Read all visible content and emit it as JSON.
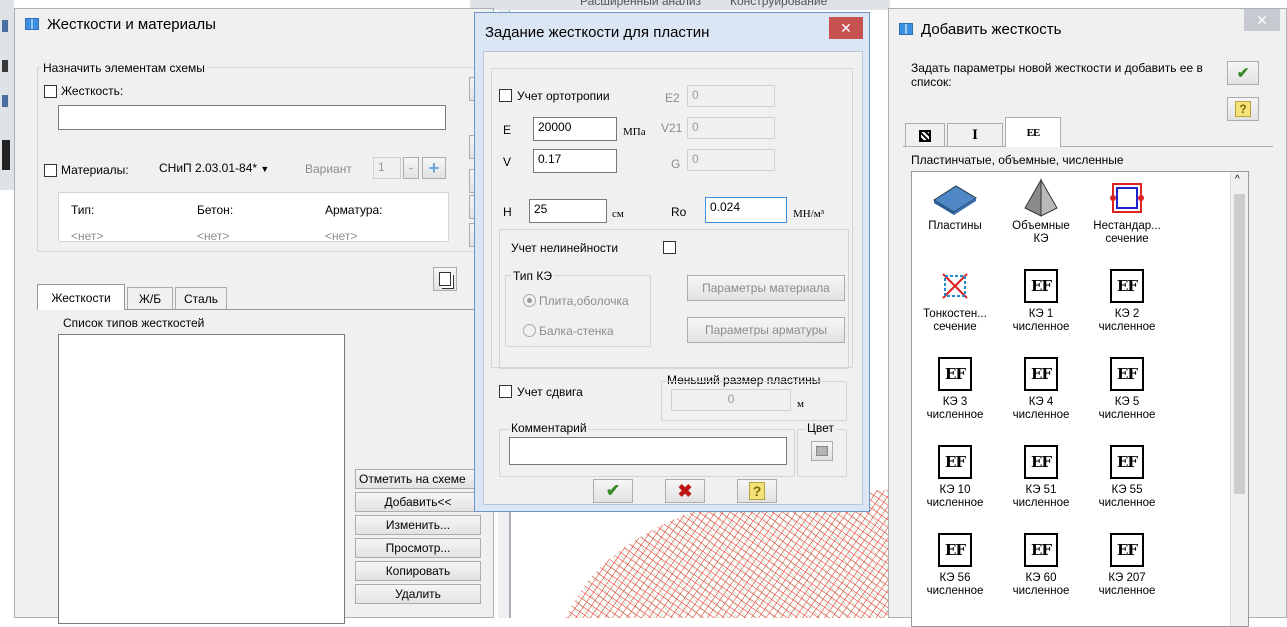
{
  "bg_menu": {
    "item1": "Расширенный анализ",
    "item2": "Конструирование"
  },
  "left_window": {
    "title": "Жесткости и материалы",
    "assign_group": "Назначить элементам схемы",
    "stiffness_label": "Жесткость:",
    "stiffness_value": "",
    "materials_label": "Материалы:",
    "norm_value": "СНиП 2.03.01-84*",
    "variant_label": "Вариант",
    "variant_value": "1",
    "table_headers": [
      "Тип:",
      "Бетон:",
      "Арматура:"
    ],
    "table_values": [
      "<нет>",
      "<нет>",
      "<нет>"
    ],
    "tabs": [
      "Жесткости",
      "Ж/Б",
      "Сталь"
    ],
    "list_label": "Список типов жесткостей",
    "buttons": {
      "mark": "Отметить на схеме",
      "add": "Добавить<<",
      "edit": "Изменить...",
      "view": "Просмотр...",
      "copy": "Копировать",
      "delete": "Удалить"
    }
  },
  "middle_dialog": {
    "title": "Задание жесткости для пластин",
    "orthotropy_label": "Учет ортотропии",
    "E_label": "E",
    "E_value": "20000",
    "E_unit": "МПа",
    "V_label": "V",
    "V_value": "0.17",
    "E2_label": "E2",
    "E2_value": "0",
    "V21_label": "V21",
    "V21_value": "0",
    "G_label": "G",
    "G_value": "0",
    "H_label": "H",
    "H_value": "25",
    "H_unit": "см",
    "Ro_label": "Ro",
    "Ro_value": "0.024",
    "Ro_unit": "МН/м³",
    "nonlinear_label": "Учет нелинейности",
    "fe_type_group": "Тип КЭ",
    "radio_plate": "Плита,оболочка",
    "radio_beam": "Балка-стенка",
    "material_params_button": "Параметры материала",
    "rebar_params_button": "Параметры арматуры",
    "shear_label": "Учет сдвига",
    "min_size_label": "Меньший размер пластины",
    "min_size_value": "0",
    "min_size_unit": "м",
    "comment_label": "Комментарий",
    "comment_value": "",
    "color_label": "Цвет",
    "ok_icon": "checkmark-icon",
    "cancel_icon": "x-icon",
    "help_symbol": "?"
  },
  "right_window": {
    "title": "Добавить жесткость",
    "description": "Задать параметры новой жесткости и добавить ее в список:",
    "help_symbol": "?",
    "tab3_label": "EE",
    "category_label": "Пластинчатые, объемные, численные",
    "items": [
      {
        "line1": "Пластины",
        "line2": "",
        "icon": "plate-icon"
      },
      {
        "line1": "Объемные",
        "line2": "КЭ",
        "icon": "pyramid-icon"
      },
      {
        "line1": "Нестандар...",
        "line2": "сечение",
        "icon": "custom-section-icon"
      },
      {
        "line1": "Тонкостен...",
        "line2": "сечение",
        "icon": "thin-wall-icon"
      },
      {
        "line1": "КЭ 1",
        "line2": "численное",
        "icon": "ef-icon"
      },
      {
        "line1": "КЭ 2",
        "line2": "численное",
        "icon": "ef-icon"
      },
      {
        "line1": "КЭ 3",
        "line2": "численное",
        "icon": "ef-icon"
      },
      {
        "line1": "КЭ 4",
        "line2": "численное",
        "icon": "ef-icon"
      },
      {
        "line1": "КЭ 5",
        "line2": "численное",
        "icon": "ef-icon"
      },
      {
        "line1": "КЭ 10",
        "line2": "численное",
        "icon": "ef-icon"
      },
      {
        "line1": "КЭ 51",
        "line2": "численное",
        "icon": "ef-icon"
      },
      {
        "line1": "КЭ 55",
        "line2": "численное",
        "icon": "ef-icon"
      },
      {
        "line1": "КЭ 56",
        "line2": "численное",
        "icon": "ef-icon"
      },
      {
        "line1": "КЭ 60",
        "line2": "численное",
        "icon": "ef-icon"
      },
      {
        "line1": "КЭ 207",
        "line2": "численное",
        "icon": "ef-icon"
      }
    ]
  },
  "icon_glyph": "EF",
  "colors": {
    "close_red": "#c75050",
    "mesh_red": "#e8201c",
    "mesh_green": "#3aa63a",
    "accent_blue": "#3d8fe0"
  }
}
